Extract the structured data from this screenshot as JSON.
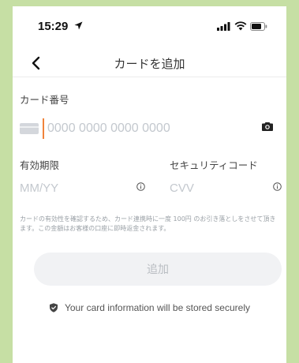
{
  "status_bar": {
    "time": "15:29"
  },
  "nav": {
    "title": "カードを追加"
  },
  "card_number": {
    "label": "カード番号",
    "placeholder": "0000 0000 0000 0000",
    "value": ""
  },
  "expiry": {
    "label": "有効期限",
    "placeholder": "MM/YY",
    "value": ""
  },
  "cvv": {
    "label": "セキュリティコード",
    "placeholder": "CVV",
    "value": ""
  },
  "notice": "カードの有効性を確認するため、カード連携時に一度 100円 のお引き落としをさせて頂きます。この金額はお客様の口座に即時返金されます。",
  "add_button": {
    "label": "追加"
  },
  "secure_message": "Your card information will be stored securely",
  "colors": {
    "page_background": "#c6dfa4",
    "cursor_accent": "#f0833a",
    "button_background": "#f1f2f4",
    "button_text": "#b9bdc2"
  },
  "icons": [
    "location-arrow-icon",
    "signal-icon",
    "wifi-icon",
    "battery-icon",
    "back-chevron-icon",
    "card-chip-icon",
    "camera-icon",
    "info-icon",
    "shield-icon"
  ]
}
